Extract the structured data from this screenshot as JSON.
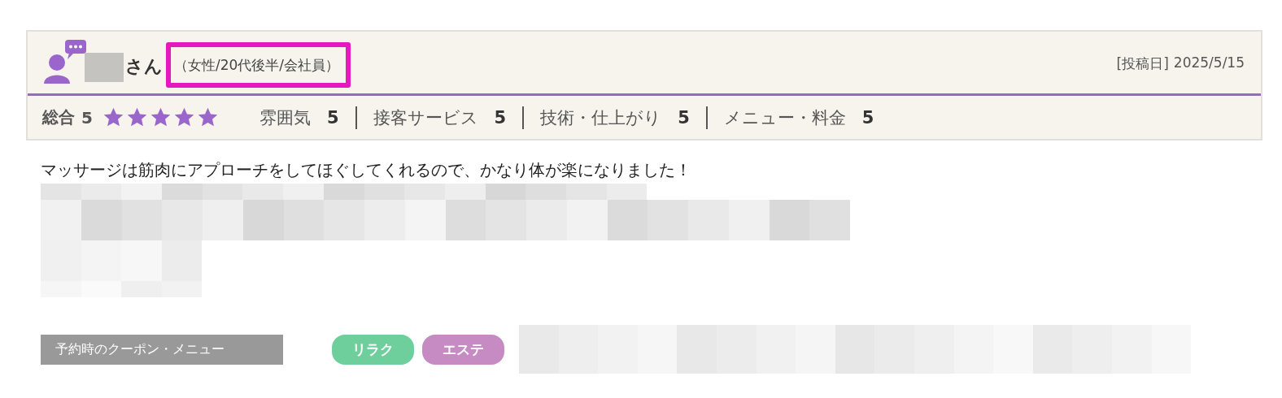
{
  "review": {
    "name_suffix": "さん",
    "reviewer_profile": "（女性/20代後半/会社員）",
    "post_date_label": "[投稿日]",
    "post_date": "2025/5/15",
    "overall": {
      "label": "総合",
      "score": "5",
      "stars": 5
    },
    "ratings": [
      {
        "label": "雰囲気",
        "score": "5"
      },
      {
        "label": "接客サービス",
        "score": "5"
      },
      {
        "label": "技術・仕上がり",
        "score": "5"
      },
      {
        "label": "メニュー・料金",
        "score": "5"
      }
    ],
    "body": "マッサージは筋肉にアプローチをしてほぐしてくれるので、かなり体が楽になりました！",
    "coupon_label": "予約時のクーポン・メニュー",
    "tags": [
      {
        "label": "リラク",
        "color": "#6fcf9c"
      },
      {
        "label": "エステ",
        "color": "#c58bc2"
      }
    ]
  }
}
